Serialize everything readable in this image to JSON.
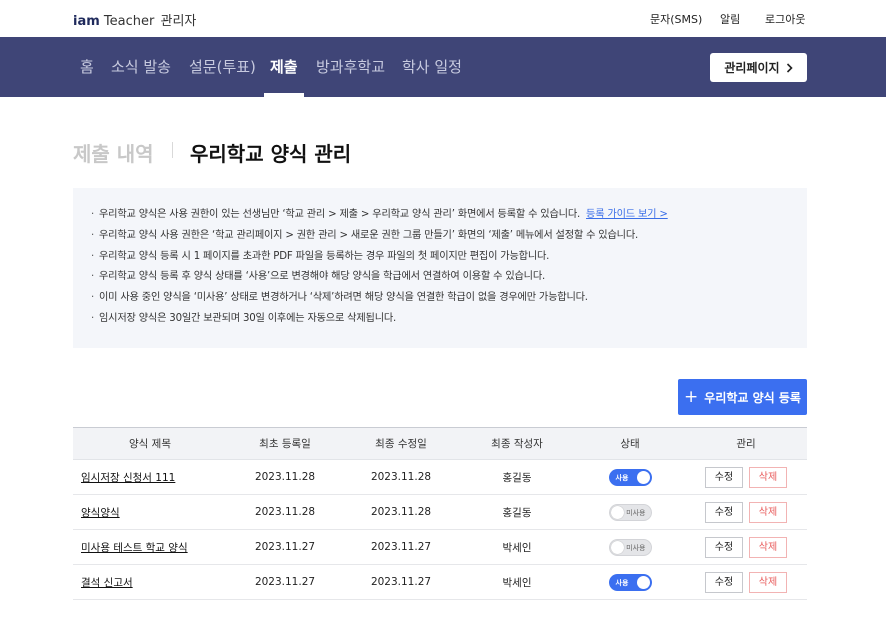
{
  "brand": {
    "iam": "iam",
    "teacher": "Teacher",
    "admin": "관리자"
  },
  "util_links": [
    "문자(SMS)",
    "알림",
    "로그아웃"
  ],
  "nav": {
    "items": [
      "홈",
      "소식 발송",
      "설문(투표)",
      "제출",
      "방과후학교",
      "학사 일정"
    ],
    "active": "제출",
    "admin_button": "관리페이지",
    "admin_button_icon": "chevron-right-icon"
  },
  "title": {
    "section": "제출 내역",
    "page": "우리학교 양식 관리"
  },
  "notice": {
    "lines": [
      "우리학교 양식은 사용 권한이 있는 선생님만 ‘학교 관리 > 제출 > 우리학교 양식 관리’ 화면에서 등록할 수 있습니다.",
      "우리학교 양식 사용 권한은 ‘학교 관리페이지 > 권한 관리 > 새로운 권한 그룹 만들기’ 화면의 ‘제출’ 메뉴에서 설정할 수 있습니다.",
      "우리학교 양식 등록 시 1 페이지를 초과한 PDF 파일을 등록하는 경우 파일의 첫 페이지만 편집이 가능합니다.",
      "우리학교 양식 등록 후 양식 상태를 ‘사용’으로 변경해야 해당 양식을 학급에서 연결하여 이용할 수 있습니다.",
      "이미 사용 중인 양식을 ‘미사용’ 상태로 변경하거나 ‘삭제’하려면 해당 양식을 연결한 학급이 없을 경우에만 가능합니다.",
      "임시저장 양식은 30일간 보관되며 30일 이후에는 자동으로 삭제됩니다."
    ],
    "guide_link": "등록 가이드 보기 >"
  },
  "register_button": "우리학교 양식 등록",
  "table": {
    "headers": [
      "양식 제목",
      "최초 등록일",
      "최종 수정일",
      "최종 작성자",
      "상태",
      "관리"
    ],
    "rows": [
      {
        "title": "임시저장 신청서 111",
        "created": "2023.11.28",
        "modified": "2023.11.28",
        "author": "홍길동",
        "status": "사용",
        "on": true
      },
      {
        "title": "양식양식",
        "created": "2023.11.28",
        "modified": "2023.11.28",
        "author": "홍길동",
        "status": "미사용",
        "on": false
      },
      {
        "title": "미사용 테스트 학교 양식",
        "created": "2023.11.27",
        "modified": "2023.11.27",
        "author": "박세인",
        "status": "미사용",
        "on": false
      },
      {
        "title": "결석 신고서",
        "created": "2023.11.27",
        "modified": "2023.11.27",
        "author": "박세인",
        "status": "사용",
        "on": true
      }
    ],
    "edit_label": "수정",
    "delete_label": "삭제"
  },
  "colors": {
    "nav_bg": "#3f4577",
    "accent": "#3b6ff0",
    "delete": "#e85c5c"
  }
}
